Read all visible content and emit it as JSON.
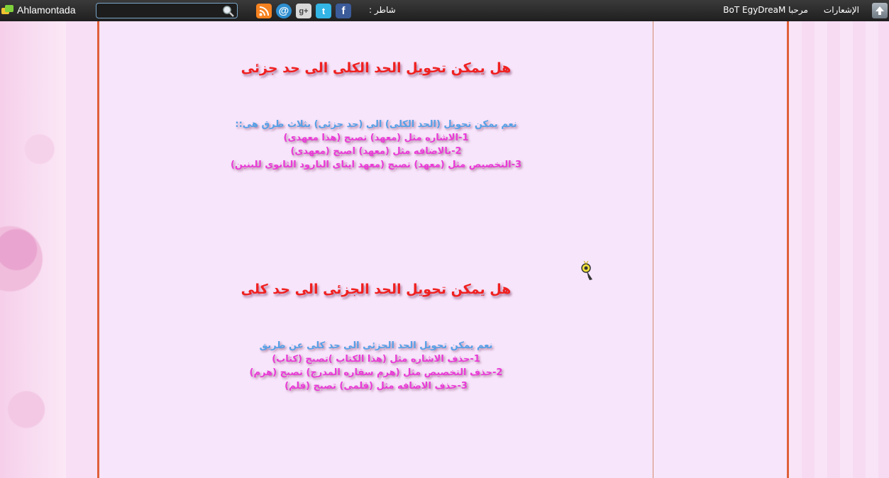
{
  "topbar": {
    "brand": "Ahlamontada",
    "search_placeholder": "",
    "share_label": "شاطر :",
    "greeting": "مرحبا",
    "username": "BoT EgyDreaM",
    "notifications": "الإشعارات",
    "social_icons": [
      "rss-icon",
      "email-icon",
      "google-plus-icon",
      "twitter-icon",
      "facebook-icon"
    ]
  },
  "colors": {
    "frame": "#e0603a",
    "title": "#f02020",
    "lead": "#56a0e6",
    "line": "#e93ad6",
    "content_bg": "#f7e5fb"
  },
  "posts": [
    {
      "title": "هل يمكن تحويل الحد الكلى الى حد جزئى",
      "lead": "نعم يمكن تحويل (الحد الكلى) الى  (حد جزئى) بثلاث طرق هى::",
      "lines": [
        "1-الاشاره مثل (معهد) تصبح (هذا معهدى)",
        "2-بالاضافه مثل (معهد) اصبح (معهدى)",
        "3-التخصيص مثل (معهد) تصبح (معهد ايتاى البارود الثانوى للبنين)"
      ]
    },
    {
      "title": "هل يمكن تحويل الحد الجزئى الى حد كلى",
      "lead": "نعم يمكن تحويل الحد الجزئى الى حد كلى عن طريق",
      "lines": [
        "1-حذف الاشاره مثل (هذا الكتاب )تصبح (كتاب)",
        "2-حذف التخصيص مثل (هرم سقاره المدرج) تصبح (هرم)",
        "3-حذف الاضافه مثل (قلمى) تصبح (قلم)"
      ]
    }
  ]
}
